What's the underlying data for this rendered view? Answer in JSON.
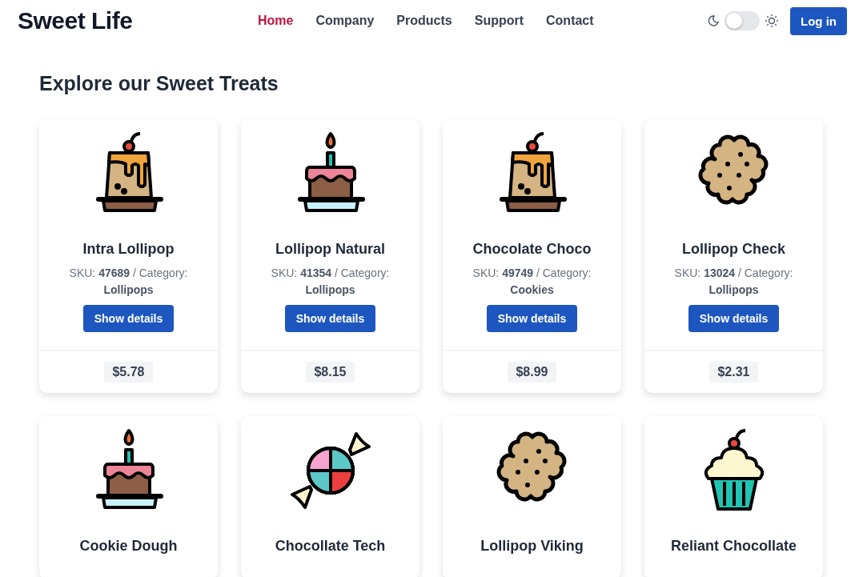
{
  "header": {
    "logo": "Sweet Life",
    "nav": [
      {
        "label": "Home",
        "selected": true
      },
      {
        "label": "Company",
        "selected": false
      },
      {
        "label": "Products",
        "selected": false
      },
      {
        "label": "Support",
        "selected": false
      },
      {
        "label": "Contact",
        "selected": false
      }
    ],
    "theme_toggle": {
      "on": false
    },
    "login": "Log in"
  },
  "heading": "Explore our Sweet Treats",
  "products": [
    {
      "kind": "pudding",
      "name": "Intra Lollipop",
      "sku_line": "SKU: **47689** / Category: **Lollipops**",
      "button": "Show details",
      "price": "$5.78"
    },
    {
      "kind": "cake",
      "name": "Lollipop Natural",
      "sku_line": "SKU: **41354** / Category: **Lollipops**",
      "button": "Show details",
      "price": "$8.15"
    },
    {
      "kind": "pudding",
      "name": "Chocolate Choco",
      "sku_line": "SKU: **49749** / Category: **Cookies**",
      "button": "Show details",
      "price": "$8.99"
    },
    {
      "kind": "cookie",
      "name": "Lollipop Check",
      "sku_line": "SKU: **13024** / Category: **Lollipops**",
      "button": "Show details",
      "price": "$2.31"
    },
    {
      "kind": "cake",
      "name": "Cookie Dough"
    },
    {
      "kind": "candy",
      "name": "Chocollate Tech"
    },
    {
      "kind": "cookie",
      "name": "Lollipop Viking"
    },
    {
      "kind": "cupcake",
      "name": "Reliant Chocollate"
    }
  ]
}
